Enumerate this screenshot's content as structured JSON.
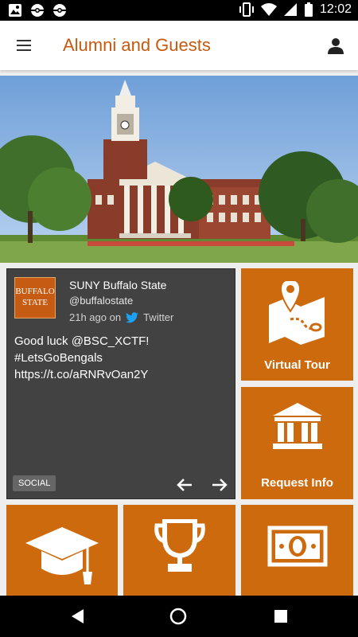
{
  "status_bar": {
    "time": "12:02",
    "left_icons": [
      "photo-notification-icon",
      "pokeball-notification-icon",
      "pokeball-notification-icon"
    ],
    "right_icons": [
      "vibrate-icon",
      "wifi-icon",
      "signal-icon",
      "battery-icon"
    ]
  },
  "app_bar": {
    "title": "Alumni and Guests",
    "menu_icon": "hamburger-menu-icon",
    "account_icon": "account-icon"
  },
  "colors": {
    "accent": "#c85a0f",
    "tile": "#cc6a0d",
    "social_card": "#424242"
  },
  "social_card": {
    "logo_text": "BUFFALO STATE",
    "name": "SUNY Buffalo State",
    "handle": "@buffalostate",
    "time": "21h ago on",
    "source": "Twitter",
    "body_lines": [
      "Good luck @BSC_XCTF!",
      "#LetsGoBengals",
      "https://t.co/aRNRvOan2Y"
    ],
    "tag": "SOCIAL"
  },
  "tiles": {
    "virtual_tour": "Virtual Tour",
    "request_info": "Request Info",
    "graduation": "",
    "athletics": "",
    "giving": ""
  },
  "nav_bar": {
    "icons": [
      "back-icon",
      "home-icon",
      "recents-icon"
    ]
  }
}
